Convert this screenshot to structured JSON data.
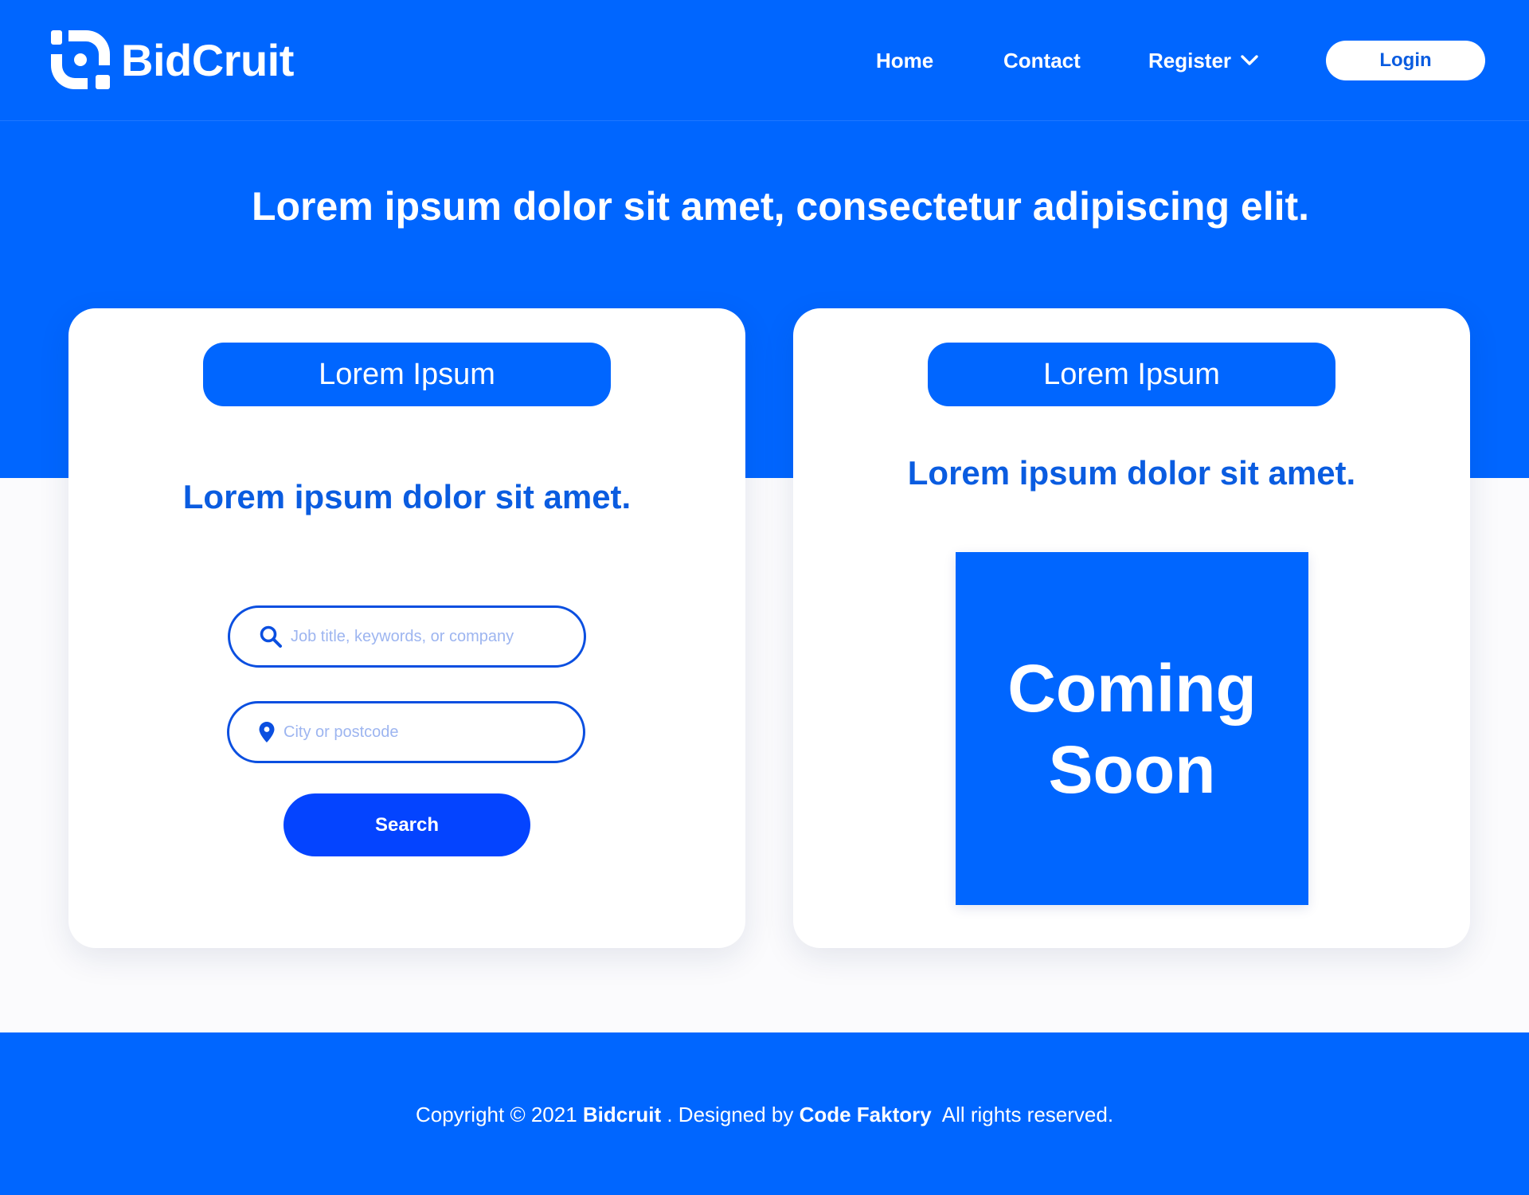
{
  "brand": {
    "name": "BidCruit",
    "logo_icon": "bidcruit-logo-icon",
    "primary_color": "#0066FF",
    "button_color": "#0444FF",
    "accent_text_color": "#0A5CE0"
  },
  "nav": {
    "home": "Home",
    "contact": "Contact",
    "register": "Register",
    "register_icon": "chevron-down-icon",
    "login": "Login"
  },
  "hero": {
    "headline": "Lorem ipsum dolor sit amet, consectetur adipiscing elit."
  },
  "search_card": {
    "pill_label": "Lorem Ipsum",
    "heading": "Lorem ipsum dolor sit amet.",
    "job_field": {
      "icon": "search-icon",
      "placeholder": "Job title, keywords, or company",
      "value": ""
    },
    "location_field": {
      "icon": "map-pin-icon",
      "placeholder": "City or postcode",
      "value": ""
    },
    "search_button": "Search"
  },
  "soon_card": {
    "pill_label": "Lorem Ipsum",
    "heading": "Lorem ipsum dolor sit amet.",
    "tile_line1": "Coming",
    "tile_line2": "Soon"
  },
  "footer": {
    "prefix": "Copyright © 2021 ",
    "brand": "Bidcruit",
    "designed_by": " . Designed by ",
    "designer": "Code Faktory",
    "suffix": "  All rights reserved."
  }
}
